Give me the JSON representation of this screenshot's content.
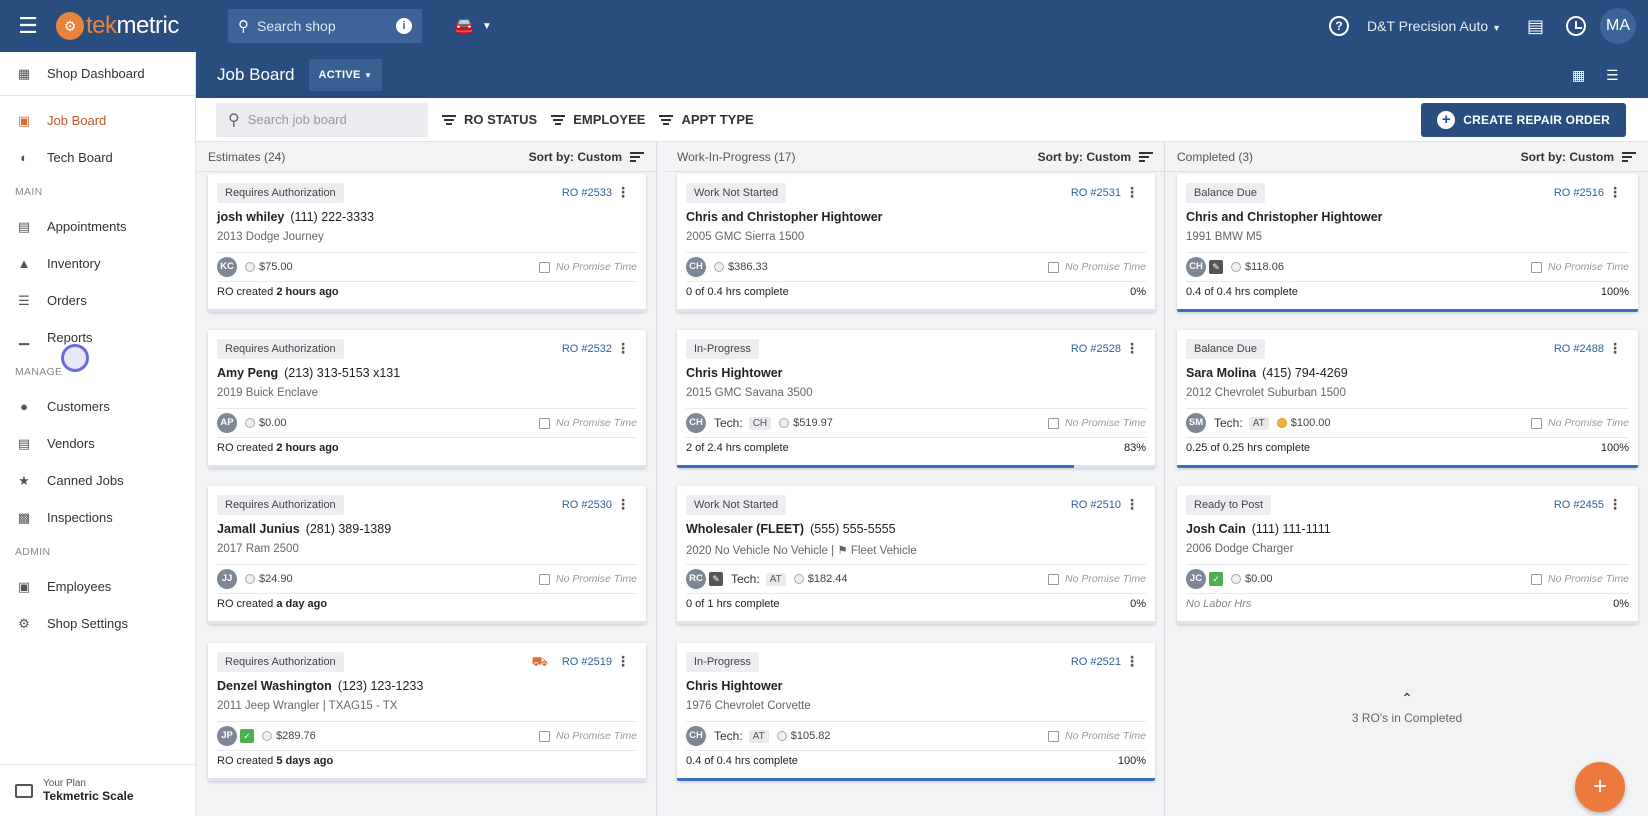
{
  "topbar": {
    "logo": "tekmetric",
    "search_placeholder": "Search shop",
    "shop_name": "D&T Precision Auto",
    "user_initials": "MA"
  },
  "sidebar": {
    "top": "Shop Dashboard",
    "items": [
      {
        "label": "Job Board"
      },
      {
        "label": "Tech Board"
      }
    ],
    "sections": [
      "MAIN",
      "MANAGE",
      "ADMIN"
    ],
    "main_items": [
      "Appointments",
      "Inventory",
      "Orders",
      "Reports"
    ],
    "manage_items": [
      "Customers",
      "Vendors",
      "Canned Jobs",
      "Inspections"
    ],
    "admin_items": [
      "Employees",
      "Shop Settings"
    ],
    "plan_label": "Your Plan",
    "plan_name": "Tekmetric Scale"
  },
  "header": {
    "title": "Job Board",
    "status": "ACTIVE"
  },
  "toolbar": {
    "search_placeholder": "Search job board",
    "filters": [
      "RO STATUS",
      "EMPLOYEE",
      "APPT TYPE"
    ],
    "create_label": "CREATE REPAIR ORDER"
  },
  "columns": [
    {
      "title": "Estimates (24)",
      "sort": "Sort by: Custom",
      "cards": [
        {
          "badge": "Requires Authorization",
          "ro": "RO #2533",
          "name": "josh whiley",
          "phone": "(111) 222-3333",
          "vehicle": "2013 Dodge Journey",
          "avatar": "KC",
          "price": "$75.00",
          "promise": "No Promise Time",
          "bottom_prefix": "RO created",
          "bottom_bold": "2 hours ago",
          "progress": 0
        },
        {
          "badge": "Requires Authorization",
          "ro": "RO #2532",
          "name": "Amy Peng",
          "phone": "(213) 313-5153 x131",
          "vehicle": "2019 Buick Enclave",
          "avatar": "AP",
          "price": "$0.00",
          "promise": "No Promise Time",
          "bottom_prefix": "RO created",
          "bottom_bold": "2 hours ago",
          "progress": 0
        },
        {
          "badge": "Requires Authorization",
          "ro": "RO #2530",
          "name": "Jamall Junius",
          "phone": "(281) 389-1389",
          "vehicle": "2017 Ram 2500",
          "avatar": "JJ",
          "price": "$24.90",
          "promise": "No Promise Time",
          "bottom_prefix": "RO created",
          "bottom_bold": "a day ago",
          "progress": 0
        },
        {
          "badge": "Requires Authorization",
          "ro": "RO #2519",
          "name": "Denzel Washington",
          "phone": "(123) 123-1233",
          "vehicle": "2011 Jeep Wrangler | TXAG15 - TX",
          "avatar": "JP",
          "price": "$289.76",
          "promise": "No Promise Time",
          "bottom_prefix": "RO created",
          "bottom_bold": "5 days ago",
          "progress": 0,
          "tow": true,
          "green_icon": true
        }
      ]
    },
    {
      "title": "Work-In-Progress (17)",
      "sort": "Sort by: Custom",
      "cards": [
        {
          "badge": "Work Not Started",
          "ro": "RO #2531",
          "name": "Chris and Christopher Hightower",
          "phone": "",
          "vehicle": "2005 GMC Sierra 1500",
          "avatar": "CH",
          "price": "$386.33",
          "promise": "No Promise Time",
          "hrs": "0 of 0.4 hrs complete",
          "pct": "0%",
          "progress": 0
        },
        {
          "badge": "In-Progress",
          "ro": "RO #2528",
          "name": "Chris Hightower",
          "phone": "",
          "vehicle": "2015 GMC Savana 3500",
          "avatar": "CH",
          "tech": "CH",
          "price": "$519.97",
          "promise": "No Promise Time",
          "hrs": "2 of 2.4 hrs complete",
          "pct": "83%",
          "progress": 83
        },
        {
          "badge": "Work Not Started",
          "ro": "RO #2510",
          "name": "Wholesaler (FLEET)",
          "phone": "(555) 555-5555",
          "vehicle": "2020 No Vehicle No Vehicle |",
          "tag": "Fleet Vehicle",
          "avatar": "RC",
          "tech": "AT",
          "price": "$182.44",
          "promise": "No Promise Time",
          "hrs": "0 of 1 hrs complete",
          "pct": "0%",
          "progress": 0,
          "dark_icon": true
        },
        {
          "badge": "In-Progress",
          "ro": "RO #2521",
          "name": "Chris Hightower",
          "phone": "",
          "vehicle": "1976 Chevrolet Corvette",
          "avatar": "CH",
          "tech": "AT",
          "price": "$105.82",
          "promise": "No Promise Time",
          "hrs": "0.4 of 0.4 hrs complete",
          "pct": "100%",
          "progress": 100
        }
      ]
    },
    {
      "title": "Completed (3)",
      "sort": "Sort by: Custom",
      "cards": [
        {
          "badge": "Balance Due",
          "ro": "RO #2516",
          "name": "Chris and Christopher Hightower",
          "phone": "",
          "vehicle": "1991 BMW M5",
          "avatar": "CH",
          "price": "$118.06",
          "promise": "No Promise Time",
          "hrs": "0.4 of 0.4 hrs complete",
          "pct": "100%",
          "progress": 100,
          "dark_icon": true
        },
        {
          "badge": "Balance Due",
          "ro": "RO #2488",
          "name": "Sara Molina",
          "phone": "(415) 794-4269",
          "vehicle": "2012 Chevrolet Suburban 1500",
          "avatar": "SM",
          "tech": "AT",
          "price": "$100.00",
          "promise": "No Promise Time",
          "hrs": "0.25 of 0.25 hrs complete",
          "pct": "100%",
          "progress": 100,
          "gold": true
        },
        {
          "badge": "Ready to Post",
          "ro": "RO #2455",
          "name": "Josh Cain",
          "phone": "(111) 111-1111",
          "vehicle": "2006 Dodge Charger",
          "avatar": "JC",
          "price": "$0.00",
          "promise": "No Promise Time",
          "hrs": "No Labor Hrs",
          "pct": "0%",
          "progress": 0,
          "green_icon": true,
          "muted_hrs": true
        }
      ],
      "more": "3 RO's in Completed"
    }
  ],
  "tech_label": "Tech:",
  "fab": "+"
}
